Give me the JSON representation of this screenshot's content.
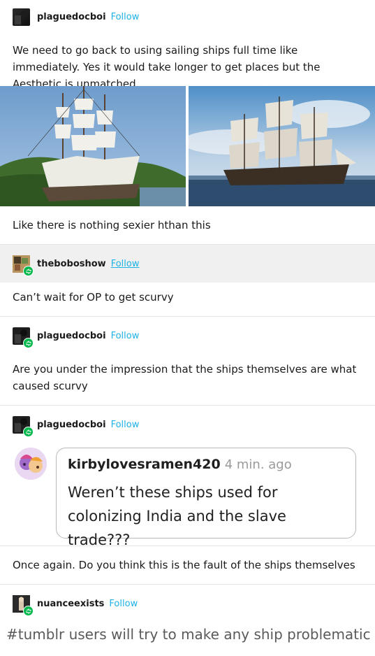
{
  "posts": [
    {
      "username": "plaguedocboi",
      "follow_label": "Follow",
      "body": "We need to go back to using sailing ships full time like immediately. Yes it would take longer to get places but the Aesthetic is unmatched",
      "caption": "Like there is nothing sexier hthan this"
    },
    {
      "username": "theboboshow",
      "follow_label": "Follow",
      "body": "Can’t wait for OP to get scurvy"
    },
    {
      "username": "plaguedocboi",
      "follow_label": "Follow",
      "body": "Are you under the impression that the ships themselves are what caused scurvy"
    },
    {
      "username": "plaguedocboi",
      "follow_label": "Follow",
      "quote": {
        "name": "kirbylovesramen420",
        "time": "4 min. ago",
        "text": "Weren’t these ships used for colonizing India and the slave trade???"
      },
      "body": "Once again. Do you think this is the fault of the ships themselves"
    },
    {
      "username": "nuanceexists",
      "follow_label": "Follow",
      "tags": "#tumblr users will try to make any ship problematic"
    }
  ],
  "colors": {
    "follow": "#1eb2e6",
    "reblog_badge": "#00b84b",
    "divider": "#e6e6e6",
    "highlight_bg": "#f0f0f0"
  },
  "icons": {
    "reblog": "reblog-icon"
  }
}
